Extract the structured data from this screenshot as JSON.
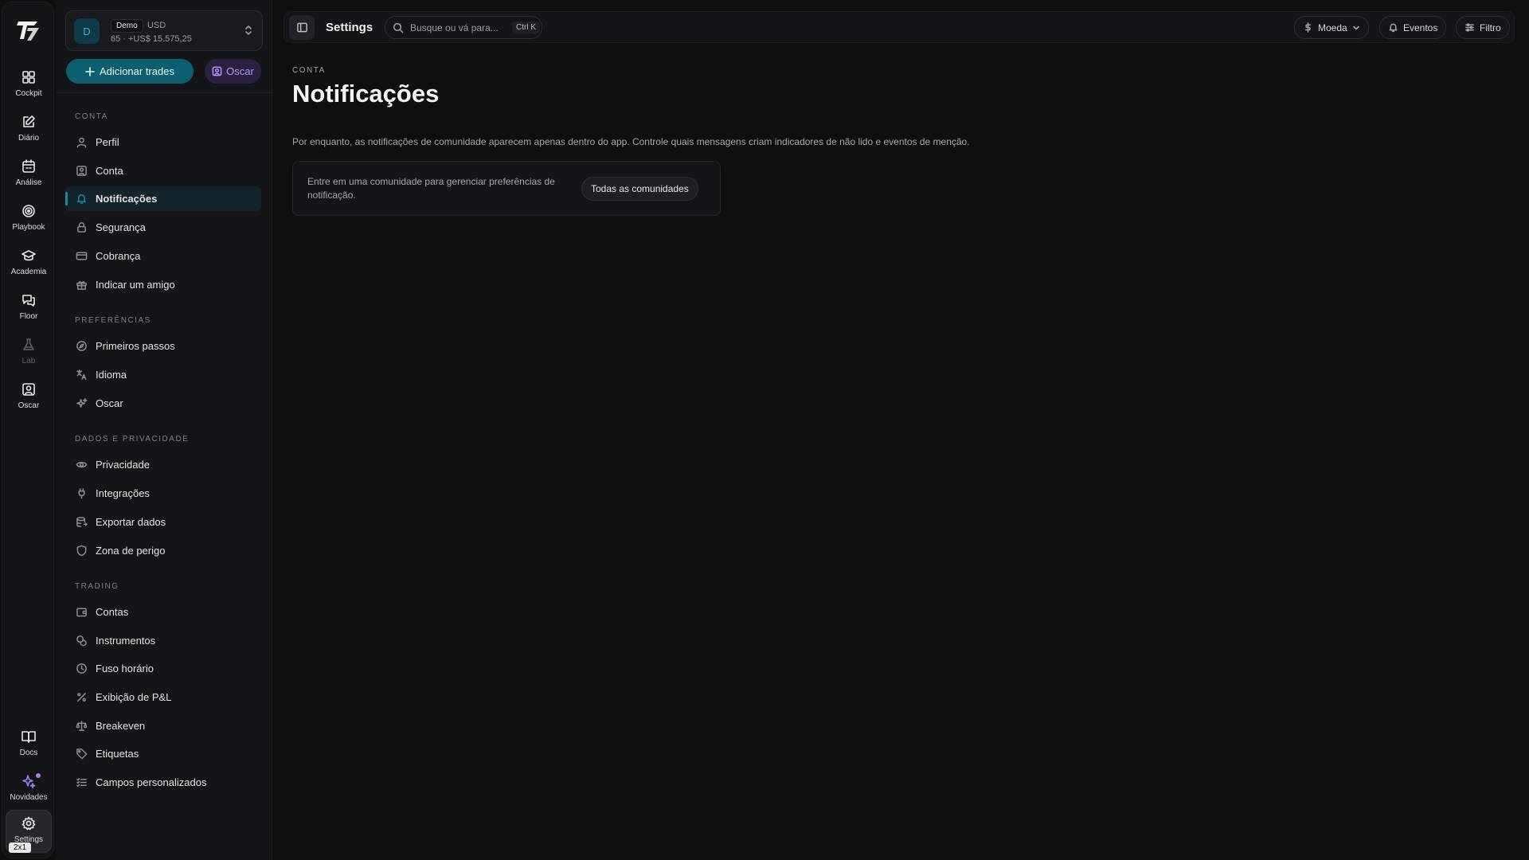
{
  "rail": {
    "items": [
      {
        "label": "Cockpit",
        "icon": "grid-icon"
      },
      {
        "label": "Diário",
        "icon": "edit-note-icon"
      },
      {
        "label": "Análise",
        "icon": "calendar-icon"
      },
      {
        "label": "Playbook",
        "icon": "target-icon"
      },
      {
        "label": "Academia",
        "icon": "graduation-cap-icon"
      },
      {
        "label": "Floor",
        "icon": "chat-icon"
      },
      {
        "label": "Lab",
        "icon": "flask-icon"
      },
      {
        "label": "Oscar",
        "icon": "user-square-icon"
      }
    ],
    "bottom": [
      {
        "label": "Docs",
        "icon": "book-icon"
      },
      {
        "label": "Novidades",
        "icon": "sparkles-icon"
      },
      {
        "label": "Settings",
        "icon": "gear-icon"
      }
    ],
    "zoom_badge": "2x1"
  },
  "account": {
    "avatar_letter": "D",
    "badge": "Demo",
    "currency": "USD",
    "summary": "65 · +US$ 15.575,25"
  },
  "actions": {
    "add_trades": "Adicionar trades",
    "oscar": "Oscar"
  },
  "nav": {
    "sections": [
      {
        "title": "CONTA",
        "items": [
          "Perfil",
          "Conta",
          "Notificações",
          "Segurança",
          "Cobrança",
          "Indicar um amigo"
        ]
      },
      {
        "title": "PREFERÊNCIAS",
        "items": [
          "Primeiros passos",
          "Idioma",
          "Oscar"
        ]
      },
      {
        "title": "DADOS E PRIVACIDADE",
        "items": [
          "Privacidade",
          "Integrações",
          "Exportar dados",
          "Zona de perigo"
        ]
      },
      {
        "title": "TRADING",
        "items": [
          "Contas",
          "Instrumentos",
          "Fuso horário",
          "Exibição de P&L",
          "Breakeven",
          "Etiquetas",
          "Campos personalizados"
        ]
      }
    ],
    "active": "Notificações"
  },
  "topbar": {
    "title": "Settings",
    "search_placeholder": "Busque ou vá para...",
    "search_shortcut": "Ctrl K",
    "currency_btn": "Moeda",
    "events_btn": "Eventos",
    "filter_btn": "Filtro"
  },
  "page": {
    "section_label": "CONTA",
    "title": "Notificações",
    "description": "Por enquanto, as notificações de comunidade aparecem apenas dentro do app. Controle quais mensagens criam indicadores de não lido e eventos de menção.",
    "card_text": "Entre em uma comunidade para gerenciar preferências de notificação.",
    "card_button": "Todas as comunidades"
  },
  "colors": {
    "background": "#0e0f11",
    "panel": "#141518",
    "accent": "#0c5f6f",
    "oscar_purple": "#b593f7"
  }
}
